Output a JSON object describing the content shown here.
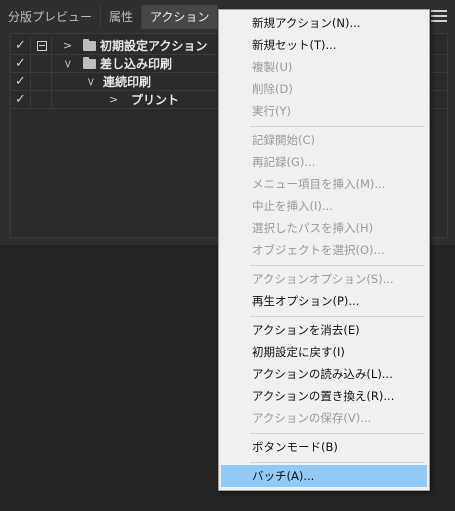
{
  "tabs": [
    "分版プレビュー",
    "属性",
    "アクション"
  ],
  "rows": [
    {
      "label": "初期設定アクション",
      "check": "✓",
      "dialog": true
    },
    {
      "label": "差し込み印刷",
      "check": "✓",
      "dialog": false
    },
    {
      "label": "連続印刷",
      "check": "✓",
      "dialog": false
    },
    {
      "label": "プリント",
      "check": "✓",
      "dialog": false
    }
  ],
  "menu": {
    "new_action": "新規アクション(N)...",
    "new_set": "新規セット(T)...",
    "duplicate": "複製(U)",
    "delete": "削除(D)",
    "play": "実行(Y)",
    "start_recording": "記録開始(C)",
    "record_again": "再記録(G)...",
    "insert_menu_item": "メニュー項目を挿入(M)...",
    "insert_stop": "中止を挿入(I)...",
    "insert_selected_path": "選択したパスを挿入(H)",
    "select_object": "オブジェクトを選択(O)...",
    "action_options": "アクションオプション(S)...",
    "playback_options": "再生オプション(P)...",
    "clear_actions": "アクションを消去(E)",
    "reset_actions": "初期設定に戻す(I)",
    "load_actions": "アクションの読み込み(L)...",
    "replace_actions": "アクションの置き換え(R)...",
    "save_actions": "アクションの保存(V)...",
    "button_mode": "ボタンモード(B)",
    "batch": "バッチ(A)..."
  }
}
